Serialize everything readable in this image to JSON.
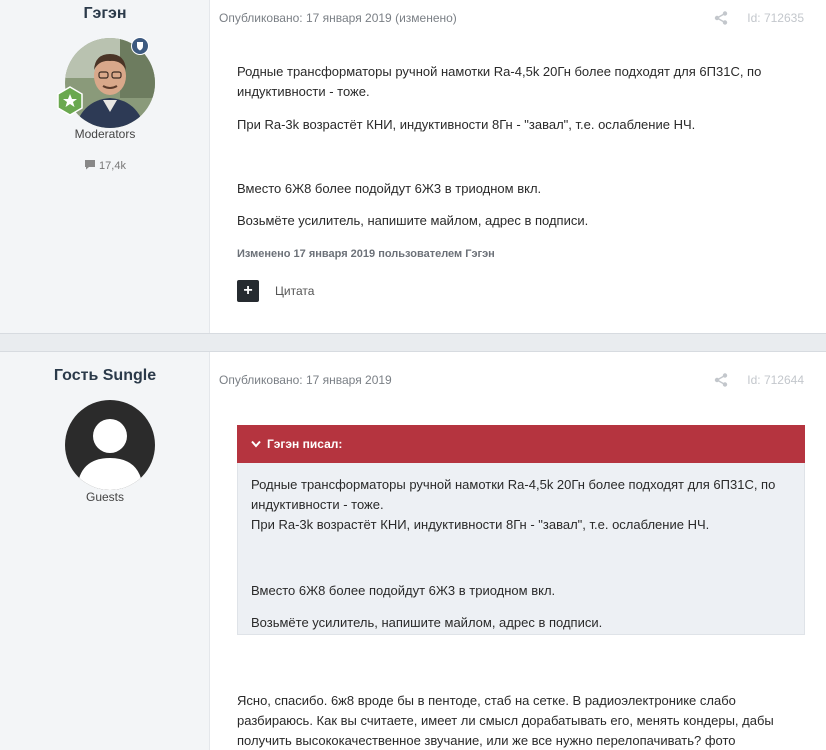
{
  "post1": {
    "author": "Гэгэн",
    "role": "Moderators",
    "reputation": "17,4k",
    "meta": "Опубликовано: 17 января 2019 (изменено)",
    "post_id": "Id: 712635",
    "p1a": "Родные трансформаторы ручной намотки Ra-4,5k 20Гн более подходят для 6П31С, по",
    "p1b": "индуктивности - тоже.",
    "p2": "При Ra-3k возрастёт КНИ, индуктивности 8Гн - \"завал\", т.е. ослабление НЧ.",
    "p3": "Вместо 6Ж8 более подойдут 6Ж3 в триодном вкл.",
    "p4": "Возьмёте усилитель, напишите майлом, адрес в подписи.",
    "edited": "Изменено 17 января 2019 пользователем Гэгэн",
    "quote_btn": "Цитата"
  },
  "post2": {
    "author": "Гость Sungle",
    "role": "Guests",
    "meta": "Опубликовано: 17 января 2019",
    "post_id": "Id: 712644",
    "quote_header": "Гэгэн писал:",
    "q1a": "Родные трансформаторы ручной намотки Ra-4,5k 20Гн более подходят для 6П31С, по",
    "q1b": "индуктивности - тоже.",
    "q2": "При Ra-3k возрастёт КНИ, индуктивности 8Гн - \"завал\", т.е. ослабление НЧ.",
    "q3": "Вместо 6Ж8 более подойдут 6Ж3 в триодном вкл.",
    "q4": "Возьмёте усилитель, напишите майлом, адрес в подписи.",
    "r1": "Ясно, спасибо. 6ж8 вроде бы в пентоде, стаб на сетке. В радиоэлектронике слабо",
    "r2": "разбираюсь. Как вы считаете, имеет ли смысл дорабатывать его, менять кондеры, дабы",
    "r3": "получить высококачественное звучание, или же все нужно перелопачивать? фото"
  },
  "colors": {
    "accent": "#b5343f",
    "sidebar": "#f3f5f7",
    "badge_green": "#6aa84f",
    "badge_blue": "#3d5a80"
  },
  "icons": [
    "share-icon",
    "comment-icon",
    "chevron-down-icon",
    "star-badge-icon",
    "shield-badge-icon",
    "plus-icon"
  ]
}
